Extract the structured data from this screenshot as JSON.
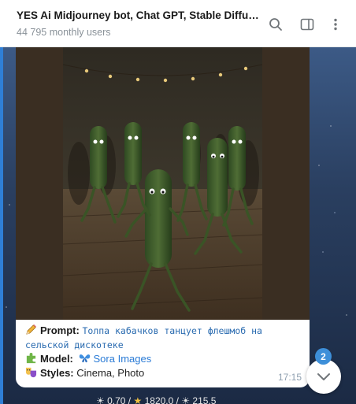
{
  "header": {
    "title": "YES Ai Midjourney bot, Chat GPT, Stable Diffusio...",
    "subtitle": "44 795 monthly users"
  },
  "icons": [
    "search-icon",
    "sidebar-toggle-icon",
    "more-vertical-icon",
    "pencil-icon",
    "puzzle-icon",
    "butterfly-icon",
    "theater-masks-icon",
    "chevron-down-icon",
    "sun-icon",
    "star-icon"
  ],
  "message": {
    "image_alt": "Dancing zucchini characters in a village disco",
    "prompt_label": "Prompt:",
    "prompt_text": "Толпа кабачков танцует флешмоб на сельской дискотеке",
    "model_label": "Model:",
    "model_name": "Sora Images",
    "styles_label": "Styles:",
    "styles_value": "Cinema, Photo",
    "time": "17:15"
  },
  "scroll": {
    "unread_count": "2"
  },
  "stats": {
    "a": "0.70",
    "b": "1820.0",
    "c": "215.5"
  },
  "colors": {
    "accent": "#3d8fd9",
    "link": "#2a7bd6",
    "header_bg": "#ffffff"
  }
}
